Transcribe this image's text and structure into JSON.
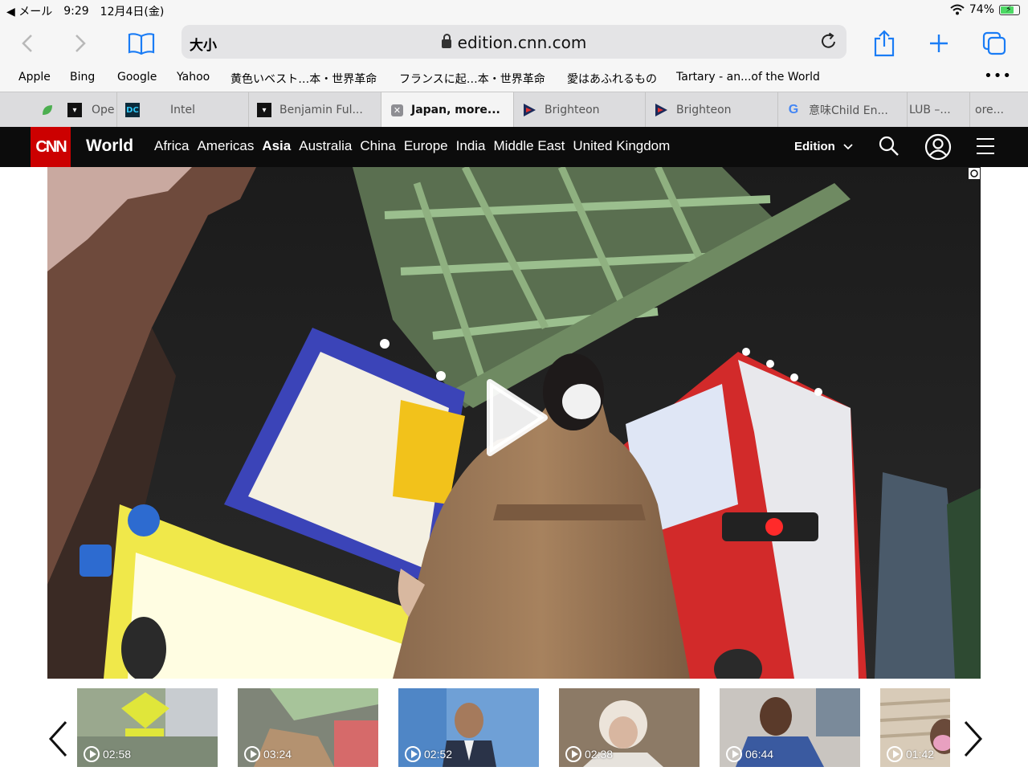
{
  "status_bar": {
    "back_app": "◀ メール",
    "time": "9:29",
    "date": "12月4日(金)",
    "battery": "74%",
    "battery_level": 0.74
  },
  "toolbar": {
    "text_size_label": "大小",
    "url": "edition.cnn.com"
  },
  "bookmarks": [
    "Apple",
    "Bing",
    "Google",
    "Yahoo",
    "黄色いベスト…本・世界革命",
    "フランスに起…本・世界革命",
    "愛はあふれるもの",
    "Tartary - an...of the World"
  ],
  "tabs": [
    {
      "label": "Ope"
    },
    {
      "label": "Intel"
    },
    {
      "label": "Benjamin Ful..."
    },
    {
      "label": "Japan, more..."
    },
    {
      "label": "Brighteon"
    },
    {
      "label": "Brighteon"
    },
    {
      "label": "意味Child En..."
    },
    {
      "label": "LUB –..."
    },
    {
      "label": "ore..."
    }
  ],
  "cnn": {
    "logo": "CNN",
    "section": "World",
    "nav": [
      "Africa",
      "Americas",
      "Asia",
      "Australia",
      "China",
      "Europe",
      "India",
      "Middle East",
      "United Kingdom"
    ],
    "active_nav": "Asia",
    "edition_label": "Edition"
  },
  "thumbnails": [
    {
      "duration": "02:58"
    },
    {
      "duration": "03:24"
    },
    {
      "duration": "02:52"
    },
    {
      "duration": "02:38"
    },
    {
      "duration": "06:44"
    },
    {
      "duration": "01:42"
    }
  ],
  "colors": {
    "cnn_red": "#cc0000",
    "nav_bg": "#0c0c0c",
    "ios_blue": "#1a7cf5"
  }
}
